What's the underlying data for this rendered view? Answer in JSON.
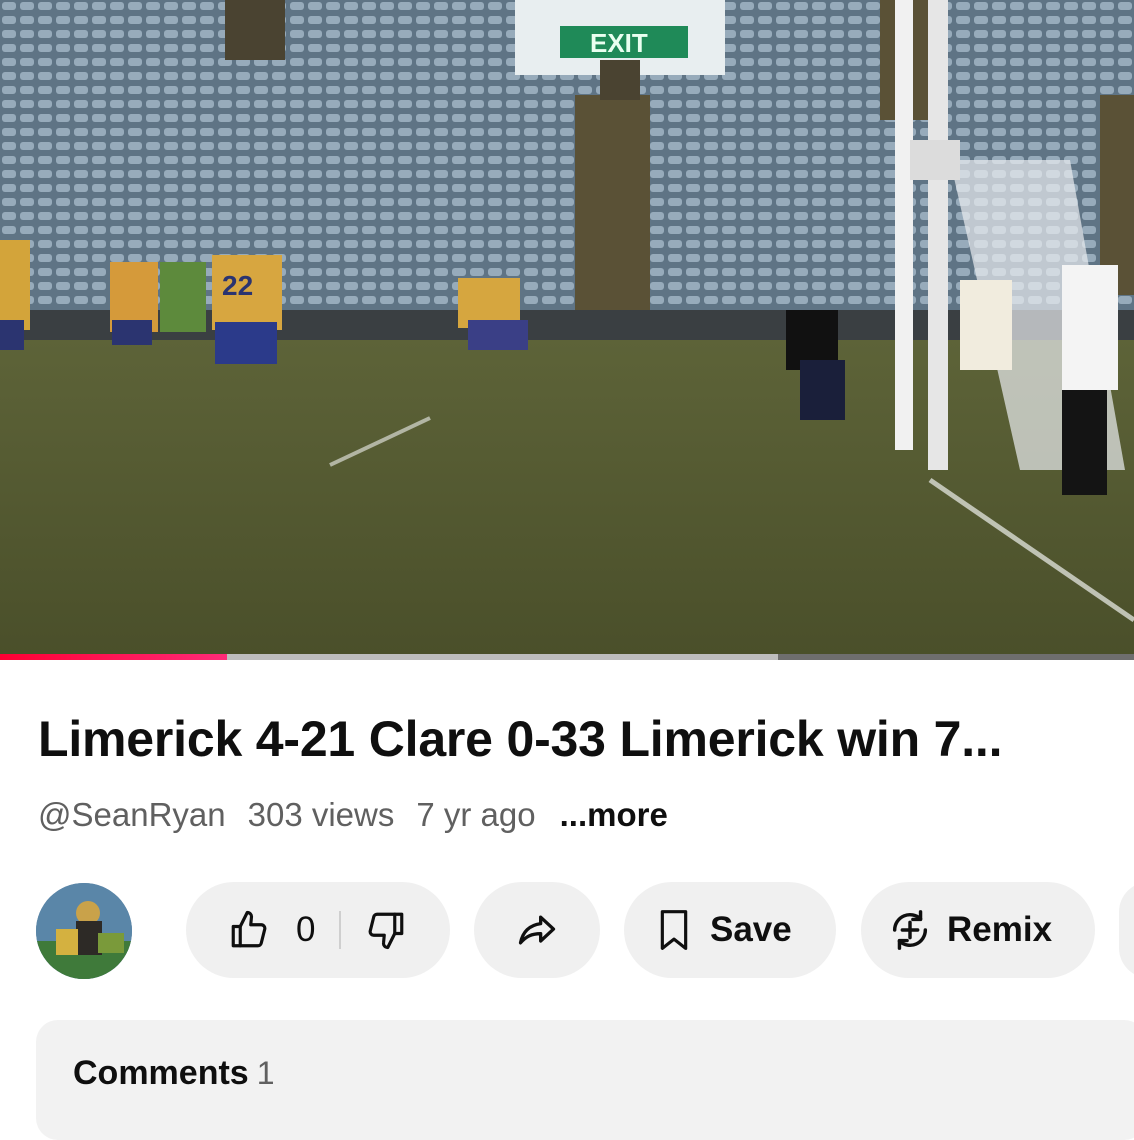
{
  "video": {
    "frame_text": {
      "exit_sign": "EXIT",
      "jersey_number": "22"
    },
    "progress": {
      "played": 0.2,
      "buffered": 0.686
    },
    "colors": {
      "played": "#ff0033",
      "buffered": "#bdbdbd",
      "track": "#6e6e6e"
    }
  },
  "details": {
    "title": "Limerick 4-21 Clare 0-33 Limerick win 7...",
    "channel": "@SeanRyan",
    "views": "303 views",
    "age": "7 yr ago",
    "more_label": "...more"
  },
  "actions": {
    "avatar_icon": "channel-avatar",
    "like_icon": "thumbs-up-icon",
    "like_count": "0",
    "dislike_icon": "thumbs-down-icon",
    "share_icon": "share-arrow-icon",
    "save_icon": "bookmark-icon",
    "save_label": "Save",
    "remix_icon": "remix-icon",
    "remix_label": "Remix"
  },
  "comments": {
    "heading": "Comments",
    "count": "1"
  }
}
